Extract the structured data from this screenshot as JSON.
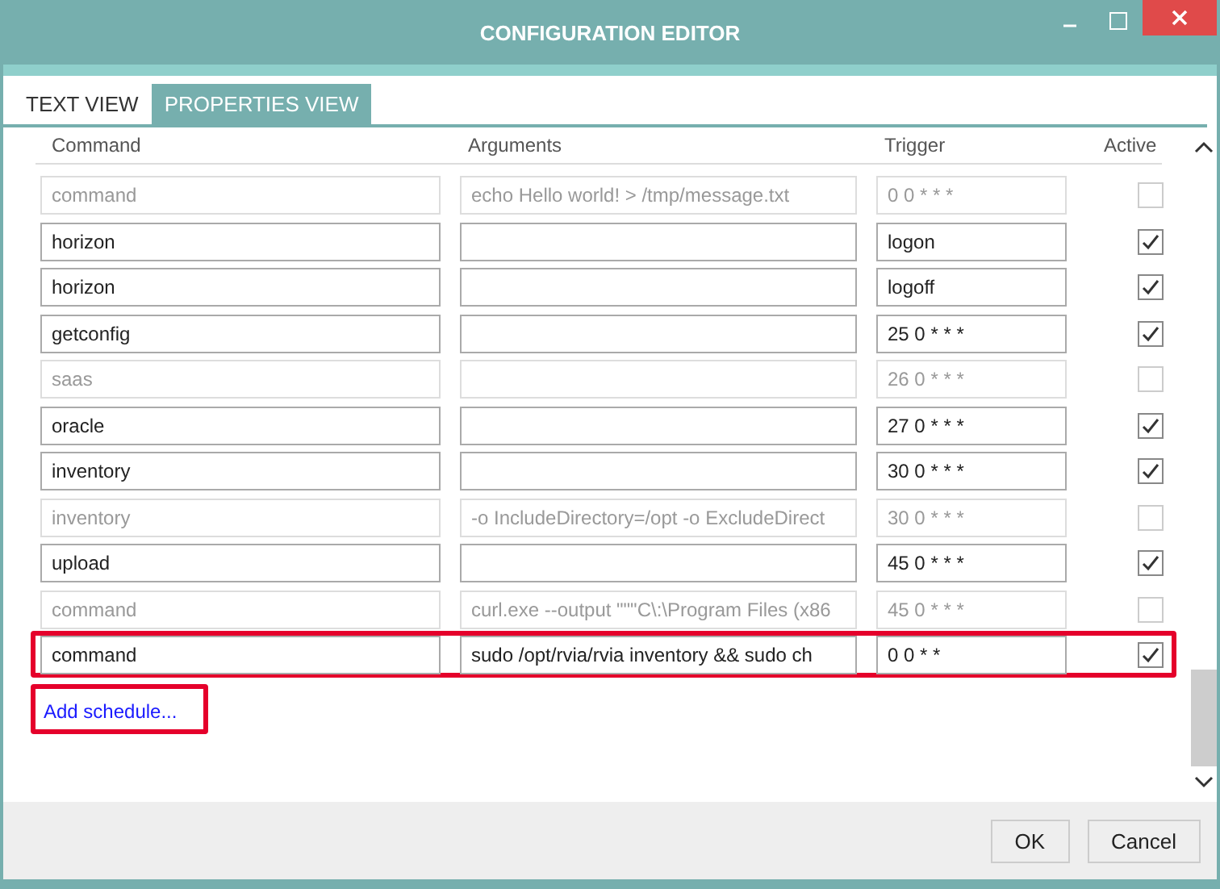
{
  "window": {
    "title": "CONFIGURATION EDITOR"
  },
  "tabs": [
    {
      "label": "TEXT VIEW",
      "selected": false
    },
    {
      "label": "PROPERTIES VIEW",
      "selected": true
    }
  ],
  "columns": [
    "Command",
    "Arguments",
    "Trigger",
    "Active"
  ],
  "rows": [
    {
      "command": "command",
      "arguments": "echo Hello world! > /tmp/message.txt",
      "trigger": "0 0 * * *",
      "active": false,
      "enabled": false,
      "highlighted": false
    },
    {
      "command": "horizon",
      "arguments": "",
      "trigger": "logon",
      "active": true,
      "enabled": true,
      "highlighted": false
    },
    {
      "command": "horizon",
      "arguments": "",
      "trigger": "logoff",
      "active": true,
      "enabled": true,
      "highlighted": false
    },
    {
      "command": "getconfig",
      "arguments": "",
      "trigger": "25 0 * * *",
      "active": true,
      "enabled": true,
      "highlighted": false
    },
    {
      "command": "saas",
      "arguments": "",
      "trigger": "26 0 * * *",
      "active": false,
      "enabled": false,
      "highlighted": false
    },
    {
      "command": "oracle",
      "arguments": "",
      "trigger": "27 0 * * *",
      "active": true,
      "enabled": true,
      "highlighted": false
    },
    {
      "command": "inventory",
      "arguments": "",
      "trigger": "30 0 * * *",
      "active": true,
      "enabled": true,
      "highlighted": false
    },
    {
      "command": "inventory",
      "arguments": "-o IncludeDirectory=/opt -o ExcludeDirect",
      "trigger": "30 0 * * *",
      "active": false,
      "enabled": false,
      "highlighted": false
    },
    {
      "command": "upload",
      "arguments": "",
      "trigger": "45 0 * * *",
      "active": true,
      "enabled": true,
      "highlighted": false
    },
    {
      "command": "command",
      "arguments": "curl.exe --output \"\"\"C\\:\\Program Files (x86",
      "trigger": "45 0 * * *",
      "active": false,
      "enabled": false,
      "highlighted": false
    },
    {
      "command": "command",
      "arguments": "sudo /opt/rvia/rvia inventory && sudo ch",
      "trigger": "0 0 * *",
      "active": true,
      "enabled": true,
      "highlighted": true
    }
  ],
  "add_link": {
    "label": "Add schedule...",
    "highlighted": true
  },
  "buttons": [
    "OK",
    "Cancel"
  ]
}
